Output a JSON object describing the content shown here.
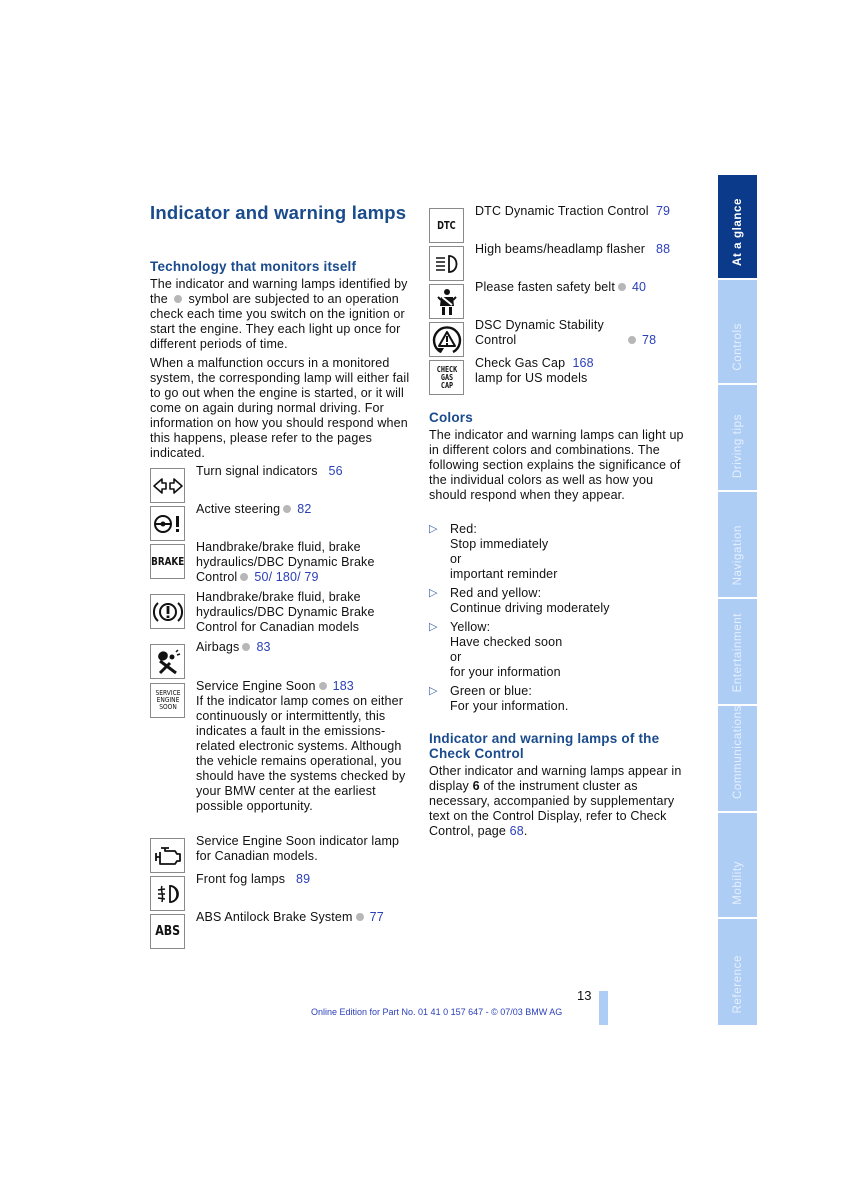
{
  "title": "Indicator and warning lamps",
  "left_column": {
    "section_heading": "Technology that monitors itself",
    "intro_pre_dot": "The indicator and warning lamps identified by the",
    "intro_post_dot": "symbol are subjected to an operation check each time you switch on the ignition or start the engine. They each light up once for different periods of time.",
    "malfunction_text": "When a malfunction occurs in a monitored system, the corresponding lamp will either fail to go out when the engine is started, or it will come on again during normal driving. For information on how you should respond when this happens, please refer to the pages indicated.",
    "lamps": [
      {
        "icon": "turn-signal-icon",
        "label": "Turn signal indicators",
        "dot": false,
        "pages": "56"
      },
      {
        "icon": "active-steering-icon",
        "label": "Active steering",
        "dot": true,
        "pages": "82"
      },
      {
        "icon": "brake-icon",
        "icon_text": "BRAKE",
        "label": "Handbrake/brake fluid, brake hydraulics/DBC Dynamic Brake Control",
        "dot": true,
        "pages": "50/ 180/ 79"
      },
      {
        "icon": "brake-canada-icon",
        "label": "Handbrake/brake fluid, brake hydraulics/DBC Dynamic Brake Control for Canadian models",
        "dot": false,
        "pages": ""
      },
      {
        "icon": "airbag-icon",
        "label": "Airbags",
        "dot": true,
        "pages": "83"
      },
      {
        "icon": "service-engine-soon-icon",
        "icon_text": "SERVICE ENGINE SOON",
        "label": "Service Engine Soon",
        "dot": true,
        "pages": "183",
        "description": "If the indicator lamp comes on either continuously or intermittently, this indicates a fault in the emissions-related electronic systems. Although the vehicle remains operational, you should have the systems checked by your BMW center at the earliest possible opportunity."
      },
      {
        "icon": "engine-icon",
        "label": "Service Engine Soon indicator lamp for Canadian models.",
        "dot": false,
        "pages": ""
      },
      {
        "icon": "front-fog-lamp-icon",
        "label": "Front fog lamps",
        "dot": false,
        "pages": "89"
      },
      {
        "icon": "abs-icon",
        "icon_text": "ABS",
        "label": "ABS Antilock Brake System",
        "dot": true,
        "pages": "77"
      }
    ]
  },
  "right_column": {
    "lamps": [
      {
        "icon": "dtc-icon",
        "icon_text": "DTC",
        "label": "DTC Dynamic Traction Control",
        "dot": false,
        "pages": "79"
      },
      {
        "icon": "high-beam-icon",
        "label": "High beams/headlamp flasher",
        "dot": false,
        "pages": "88"
      },
      {
        "icon": "safety-belt-icon",
        "label": "Please fasten safety belt",
        "dot": true,
        "pages": "40"
      },
      {
        "icon": "dsc-icon",
        "label": "DSC Dynamic Stability Control",
        "dot": true,
        "pages": "78"
      },
      {
        "icon": "check-gas-cap-icon",
        "icon_text": "CHECK GAS CAP",
        "label": "Check Gas Cap",
        "dot": false,
        "pages": "168",
        "suffix": "lamp for US models"
      }
    ],
    "colors": {
      "heading": "Colors",
      "intro": "The indicator and warning lamps can light up in different colors and combinations. The following section explains the significance of the individual colors as well as how you should respond when they appear.",
      "items": [
        {
          "lines": [
            "Red:",
            "Stop immediately",
            "or",
            "important reminder"
          ]
        },
        {
          "lines": [
            "Red and yellow:",
            "Continue driving moderately"
          ]
        },
        {
          "lines": [
            "Yellow:",
            "Have checked soon",
            "or",
            "for your information"
          ]
        },
        {
          "lines": [
            "Green or blue:",
            "For your information."
          ]
        }
      ]
    },
    "check_control": {
      "heading": "Indicator and warning lamps of the Check Control",
      "text_pre": "Other indicator and warning lamps appear in display",
      "display_number": "6",
      "text_mid": "of the instrument cluster as necessary, accompanied by supplementary text on the Control Display, refer to Check Control, page",
      "page_link": "68",
      "text_end": "."
    }
  },
  "side_tabs": [
    {
      "label": "At a glance",
      "active": true
    },
    {
      "label": "Controls",
      "active": false
    },
    {
      "label": "Driving tips",
      "active": false
    },
    {
      "label": "Navigation",
      "active": false
    },
    {
      "label": "Entertainment",
      "active": false
    },
    {
      "label": "Communications",
      "active": false
    },
    {
      "label": "Mobility",
      "active": false
    },
    {
      "label": "Reference",
      "active": false
    }
  ],
  "page_number": "13",
  "footer": "Online Edition for Part No. 01 41 0 157 647 - © 07/03 BMW AG",
  "colors_palette": {
    "heading_blue": "#1a4b8c",
    "link_blue": "#2a3fb8",
    "tab_active": "#0b3a8a",
    "tab_inactive": "#aecdf5",
    "dot_gray": "#b7b7b7"
  }
}
